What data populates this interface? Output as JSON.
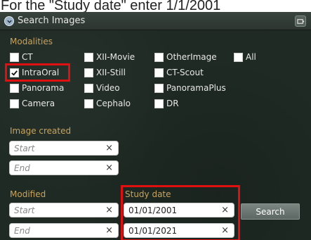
{
  "instruction": "For the \"Study date\" enter 1/1/2001",
  "panel": {
    "title": "Search Images"
  },
  "modalities": {
    "label": "Modalities",
    "items": [
      {
        "label": "CT",
        "checked": false
      },
      {
        "label": "XII-Movie",
        "checked": false
      },
      {
        "label": "OtherImage",
        "checked": false
      },
      {
        "label": "All",
        "checked": false
      },
      {
        "label": "IntraOral",
        "checked": true
      },
      {
        "label": "XII-Still",
        "checked": false
      },
      {
        "label": "CT-Scout",
        "checked": false
      },
      {
        "label": "Panorama",
        "checked": false
      },
      {
        "label": "Video",
        "checked": false
      },
      {
        "label": "PanoramaPlus",
        "checked": false
      },
      {
        "label": "Camera",
        "checked": false
      },
      {
        "label": "Cephalo",
        "checked": false
      },
      {
        "label": "DR",
        "checked": false
      }
    ]
  },
  "image_created": {
    "label": "Image created",
    "start": {
      "value": "",
      "placeholder": "Start"
    },
    "end": {
      "value": "",
      "placeholder": "End"
    }
  },
  "modified": {
    "label": "Modified",
    "start": {
      "value": "",
      "placeholder": "Start"
    },
    "end": {
      "value": "",
      "placeholder": "End"
    }
  },
  "study_date": {
    "label": "Study date",
    "start": {
      "value": "01/01/2001",
      "placeholder": "Start"
    },
    "end": {
      "value": "01/01/2021",
      "placeholder": "End"
    }
  },
  "clear_symbol": "×",
  "search_button": "Search",
  "colors": {
    "highlight": "#e01010",
    "section_label": "#c9a35b",
    "panel_bg": "#1f2a24"
  }
}
